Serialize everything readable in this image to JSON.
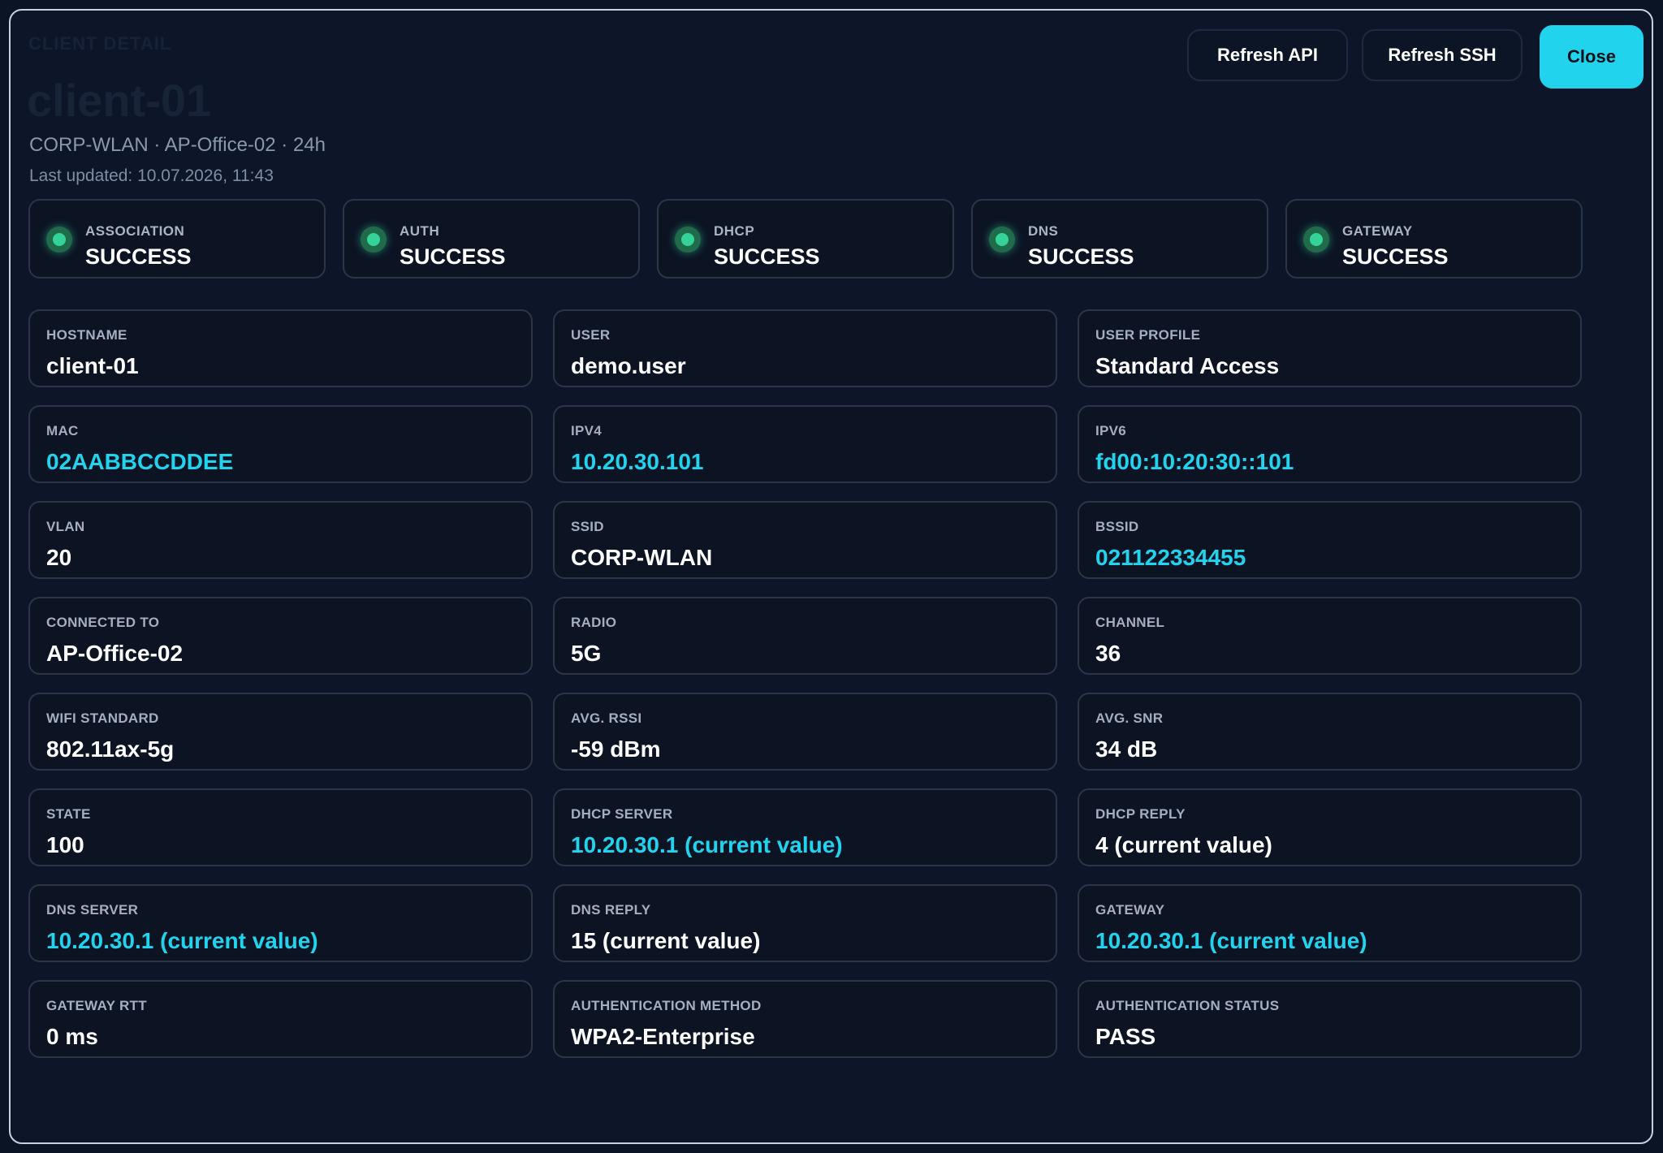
{
  "header": {
    "kicker": "CLIENT DETAIL",
    "title": "client-01",
    "subtitle": "CORP-WLAN · AP-Office-02 · 24h",
    "updated": "Last updated: 10.07.2026, 11:43"
  },
  "buttons": {
    "refresh_api": "Refresh API",
    "refresh_ssh": "Refresh SSH",
    "close": "Close"
  },
  "colors": {
    "accent": "#22d3ee",
    "success": "#34d399",
    "background": "#0d1628",
    "card": "#0c1424"
  },
  "status": [
    {
      "label": "ASSOCIATION",
      "value": "SUCCESS",
      "icon": "status-dot-icon"
    },
    {
      "label": "AUTH",
      "value": "SUCCESS",
      "icon": "status-dot-icon"
    },
    {
      "label": "DHCP",
      "value": "SUCCESS",
      "icon": "status-dot-icon"
    },
    {
      "label": "DNS",
      "value": "SUCCESS",
      "icon": "status-dot-icon"
    },
    {
      "label": "GATEWAY",
      "value": "SUCCESS",
      "icon": "status-dot-icon"
    }
  ],
  "fields": [
    {
      "label": "HOSTNAME",
      "value": "client-01",
      "accent": false
    },
    {
      "label": "USER",
      "value": "demo.user",
      "accent": false
    },
    {
      "label": "USER PROFILE",
      "value": "Standard Access",
      "accent": false
    },
    {
      "label": "MAC",
      "value": "02AABBCCDDEE",
      "accent": true
    },
    {
      "label": "IPV4",
      "value": "10.20.30.101",
      "accent": true
    },
    {
      "label": "IPV6",
      "value": "fd00:10:20:30::101",
      "accent": true
    },
    {
      "label": "VLAN",
      "value": "20",
      "accent": false
    },
    {
      "label": "SSID",
      "value": "CORP-WLAN",
      "accent": false
    },
    {
      "label": "BSSID",
      "value": "021122334455",
      "accent": true
    },
    {
      "label": "CONNECTED TO",
      "value": "AP-Office-02",
      "accent": false
    },
    {
      "label": "RADIO",
      "value": "5G",
      "accent": false
    },
    {
      "label": "CHANNEL",
      "value": "36",
      "accent": false
    },
    {
      "label": "WIFI STANDARD",
      "value": "802.11ax-5g",
      "accent": false
    },
    {
      "label": "AVG. RSSI",
      "value": "-59 dBm",
      "accent": false
    },
    {
      "label": "AVG. SNR",
      "value": "34 dB",
      "accent": false
    },
    {
      "label": "STATE",
      "value": "100",
      "accent": false
    },
    {
      "label": "DHCP SERVER",
      "value": "10.20.30.1 (current value)",
      "accent": true
    },
    {
      "label": "DHCP REPLY",
      "value": "4 (current value)",
      "accent": false
    },
    {
      "label": "DNS SERVER",
      "value": "10.20.30.1 (current value)",
      "accent": true
    },
    {
      "label": "DNS REPLY",
      "value": "15 (current value)",
      "accent": false
    },
    {
      "label": "GATEWAY",
      "value": "10.20.30.1 (current value)",
      "accent": true
    },
    {
      "label": "GATEWAY RTT",
      "value": "0 ms",
      "accent": false
    },
    {
      "label": "AUTHENTICATION METHOD",
      "value": "WPA2-Enterprise",
      "accent": false
    },
    {
      "label": "AUTHENTICATION STATUS",
      "value": "PASS",
      "accent": false
    }
  ]
}
